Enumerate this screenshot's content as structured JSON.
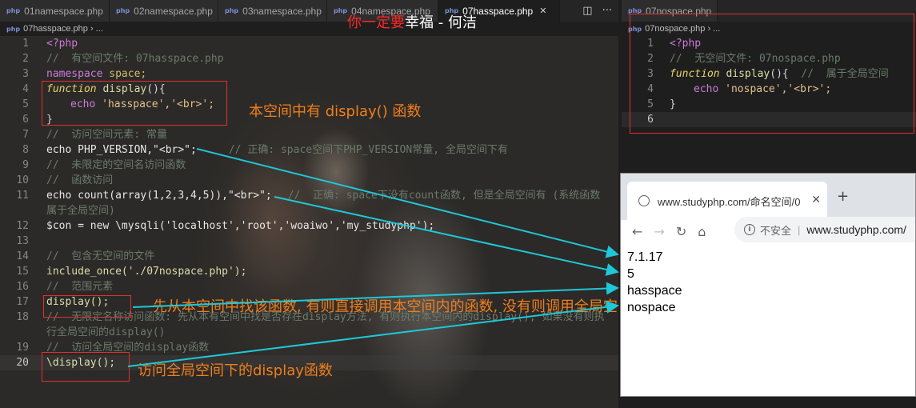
{
  "left_editor": {
    "tabs": [
      "01namespace.php",
      "02namespace.php",
      "03namespace.php",
      "04namespace.php",
      "07hasspace.php"
    ],
    "breadcrumb": "07hasspace.php › ...",
    "lines": [
      {
        "n": "1",
        "text": "<?php"
      },
      {
        "n": "2",
        "text": "//  有空间文件: 07hasspace.php"
      },
      {
        "n": "3",
        "kw": "namespace",
        "rest": " space;"
      },
      {
        "n": "4",
        "kw": "function",
        "name": " display",
        "rest": "(){"
      },
      {
        "n": "5",
        "kw": "echo",
        "s1": " 'hasspace'",
        "rest": ",'<br>';"
      },
      {
        "n": "6",
        "text": "}"
      },
      {
        "n": "7",
        "text": "//  访问空间元素: 常量"
      },
      {
        "n": "8",
        "code": "echo PHP_VERSION,\"<br>\";",
        "comment": "// 正确: space空间下PHP_VERSION常量, 全局空间下有"
      },
      {
        "n": "9",
        "text": "//  未限定的空间名访问函数"
      },
      {
        "n": "10",
        "text": "//  函数访问"
      },
      {
        "n": "11",
        "code": "echo count(array(1,2,3,4,5)),\"<br>\";",
        "comment": "//  正确: space下没有count函数, 但是全局空间有 (系统函数属于全局空间)"
      },
      {
        "n": "12",
        "code": "$con = new \\mysqli('localhost','root','woaiwo','my_studyphp');"
      },
      {
        "n": "13",
        "text": ""
      },
      {
        "n": "14",
        "text": "//  包含无空间的文件"
      },
      {
        "n": "15",
        "code": "include_once('./07nospace.php');"
      },
      {
        "n": "16",
        "text": "//  范围元素"
      },
      {
        "n": "17",
        "code": "display();"
      },
      {
        "n": "18",
        "text": "//  无限定名称访问函数: 先从本有空间中找是否存在display方法, 有则执行本空间内的display(), 如果没有则执行全局空间的display()"
      },
      {
        "n": "19",
        "text": "//  访问全局空间的display函数"
      },
      {
        "n": "20",
        "code": "\\display();"
      }
    ]
  },
  "title_overlay": {
    "red": "你一定要",
    "white": "幸福 - 何洁"
  },
  "annotations": {
    "a1": "本空间中有 display() 函数",
    "a2": "先从本空间中找该函数, 有则直接调用本空间内的函数, 没有则调用全局空间的函数",
    "a3": "访问全局空间下的display函数"
  },
  "right_editor": {
    "tab": "07nospace.php",
    "breadcrumb": "07nospace.php › ...",
    "lines": [
      {
        "n": "1",
        "text": "<?php"
      },
      {
        "n": "2",
        "text": "//  无空间文件: 07nospace.php"
      },
      {
        "n": "3",
        "kw": "function",
        "name": " display",
        "rest": "(){",
        "comment": "  //  属于全局空间"
      },
      {
        "n": "4",
        "kw": "echo",
        "s1": " 'nospace'",
        "rest": ",'<br>';"
      },
      {
        "n": "5",
        "text": "}"
      },
      {
        "n": "6",
        "text": ""
      }
    ]
  },
  "browser": {
    "tab_title": "www.studyphp.com/命名空间/0",
    "security": "不安全",
    "url": "www.studyphp.com/",
    "output": [
      "7.1.17",
      "5",
      "hasspace",
      "nospace"
    ]
  }
}
